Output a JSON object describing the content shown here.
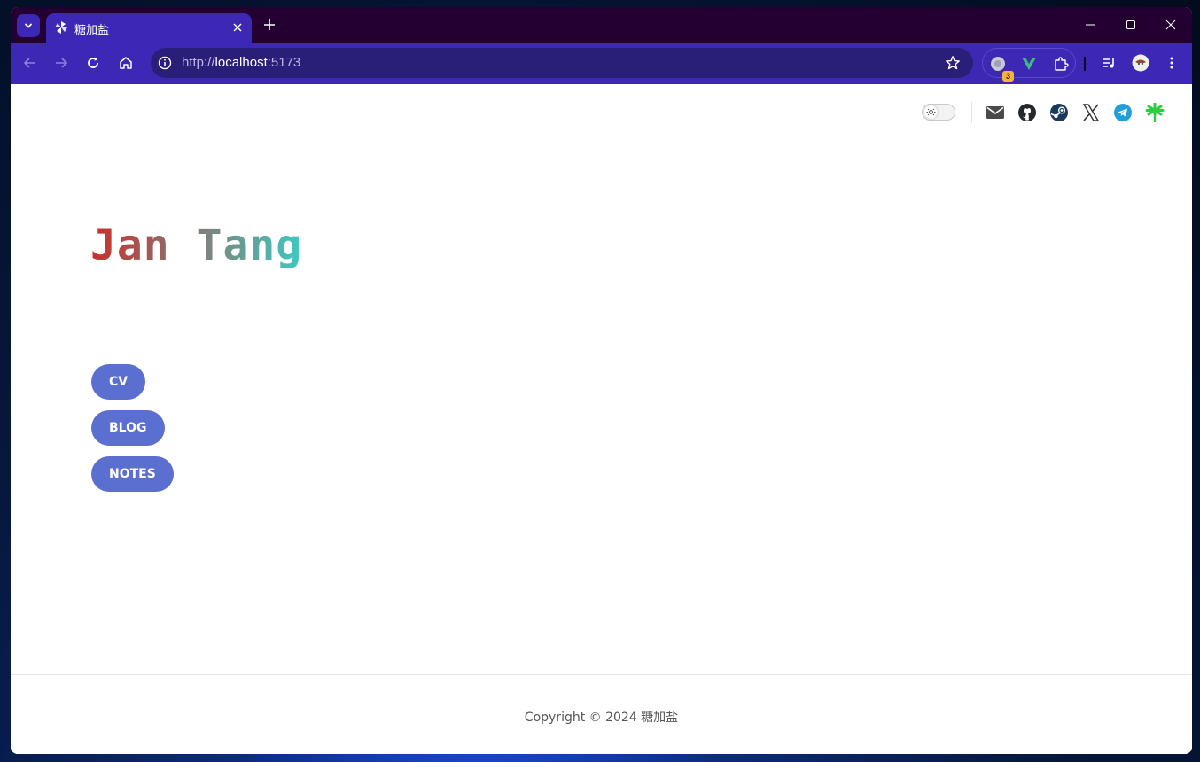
{
  "browser": {
    "tab": {
      "title": "糖加盐"
    },
    "omnibox": {
      "scheme": "http://",
      "host": "localhost",
      "port": ":5173"
    },
    "extensions": {
      "badge_count": "3"
    }
  },
  "page": {
    "logo_text": "Jan Tang",
    "logo_colors": {
      "start": "#c9302c",
      "end": "#3ec9c0"
    },
    "nav": [
      {
        "label": "CV"
      },
      {
        "label": "BLOG"
      },
      {
        "label": "NOTES"
      }
    ],
    "social_icons": [
      "mail-icon",
      "github-icon",
      "steam-icon",
      "x-icon",
      "telegram-icon",
      "asterisk-icon"
    ],
    "footer": {
      "copyright": "Copyright © 2024 糖加盐"
    },
    "colors": {
      "accent": "#5a6fd0",
      "browser_frame": "#3d27b5"
    }
  }
}
